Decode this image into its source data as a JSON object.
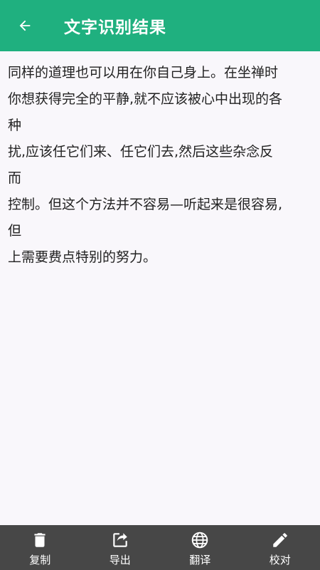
{
  "appbar": {
    "title": "文字识别结果",
    "back_icon": "arrow-left-icon",
    "background_color": "#1fb07f"
  },
  "content": {
    "lines": [
      "同样的道理也可以用在你自己身上。在坐禅时",
      "你想获得完全的平静,就不应该被心中出现的各",
      "种",
      "扰,应该任它们来、任它们去,然后这些杂念反",
      "而",
      "控制。但这个方法并不容易—听起来是很容易,",
      "但",
      "上需要费点特别的努力。"
    ]
  },
  "toolbar": {
    "background_color": "#474747",
    "items": [
      {
        "label": "复制",
        "icon": "trash-icon"
      },
      {
        "label": "导出",
        "icon": "share-icon"
      },
      {
        "label": "翻译",
        "icon": "globe-icon"
      },
      {
        "label": "校对",
        "icon": "pencil-icon"
      }
    ]
  }
}
